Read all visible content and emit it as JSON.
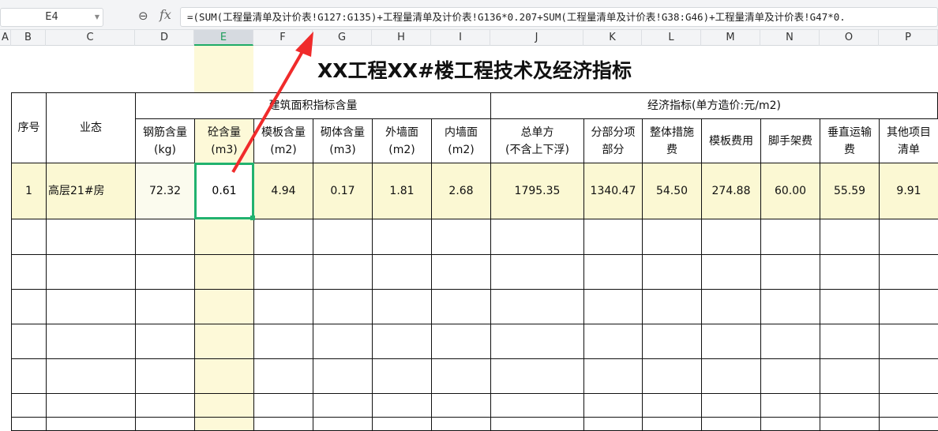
{
  "formula_bar": {
    "name_box": "E4",
    "formula": "=(SUM(工程量清单及计价表!G127:G135)+工程量清单及计价表!G136*0.207+SUM(工程量清单及计价表!G38:G46)+工程量清单及计价表!G47*0."
  },
  "columns": [
    "A",
    "B",
    "C",
    "D",
    "E",
    "F",
    "G",
    "H",
    "I",
    "J",
    "K",
    "L",
    "M",
    "N",
    "O",
    "P"
  ],
  "sheet": {
    "title": "XX工程XX#楼工程技术及经济指标",
    "h_seq": "序号",
    "h_type": "业态",
    "group1": "建筑面积指标含量",
    "group2": "经济指标(单方造价:元/m2)",
    "sub": [
      "钢筋含量\n(kg)",
      "砼含量\n(m3)",
      "模板含量\n(m2)",
      "砌体含量\n(m3)",
      "外墙面\n(m2)",
      "内墙面\n(m2)",
      "总单方\n(不含上下浮)",
      "分部分项\n部分",
      "整体措施\n费",
      "模板费用",
      "脚手架费",
      "垂直运输\n费",
      "其他项目\n清单"
    ],
    "row": {
      "seq": "1",
      "type": "高层21#房",
      "values": [
        "72.32",
        "0.61",
        "4.94",
        "0.17",
        "1.81",
        "2.68",
        "1795.35",
        "1340.47",
        "54.50",
        "274.88",
        "60.00",
        "55.59",
        "9.91"
      ]
    }
  }
}
